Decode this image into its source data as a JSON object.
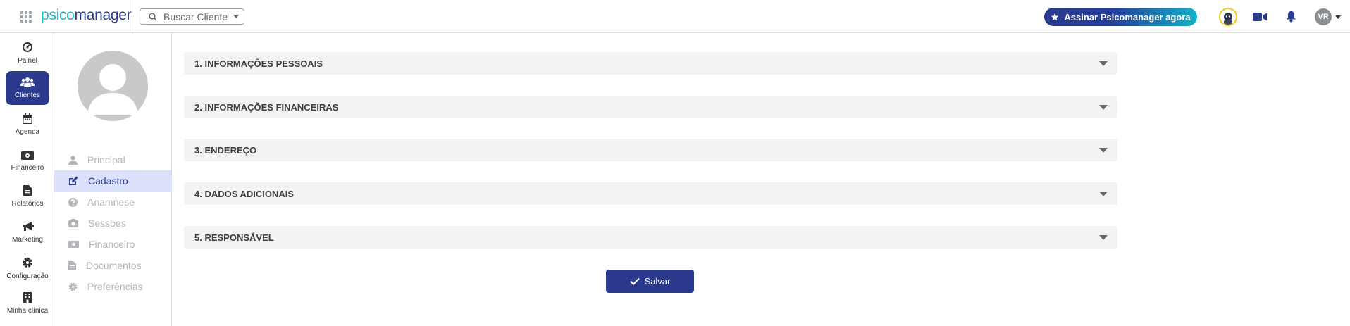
{
  "header": {
    "logo_part1": "psico",
    "logo_part2": "manager",
    "search_label": "Buscar Cliente",
    "cta_label": "Assinar Psicomanager agora",
    "user_initials": "VR"
  },
  "leftnav": {
    "items": [
      {
        "label": "Painel",
        "icon": "gauge-icon"
      },
      {
        "label": "Clientes",
        "icon": "users-icon"
      },
      {
        "label": "Agenda",
        "icon": "calendar-icon"
      },
      {
        "label": "Financeiro",
        "icon": "money-icon"
      },
      {
        "label": "Relatórios",
        "icon": "document-icon"
      },
      {
        "label": "Marketing",
        "icon": "megaphone-icon"
      },
      {
        "label": "Configuração",
        "icon": "gear-icon"
      },
      {
        "label": "Minha clínica",
        "icon": "building-icon"
      }
    ],
    "active_index": 1
  },
  "subnav": {
    "items": [
      {
        "label": "Principal",
        "icon": "user-icon"
      },
      {
        "label": "Cadastro",
        "icon": "edit-icon"
      },
      {
        "label": "Anamnese",
        "icon": "question-icon"
      },
      {
        "label": "Sessões",
        "icon": "camera-icon"
      },
      {
        "label": "Financeiro",
        "icon": "money-icon"
      },
      {
        "label": "Documentos",
        "icon": "file-icon"
      },
      {
        "label": "Preferências",
        "icon": "gear-icon"
      }
    ],
    "active_index": 1
  },
  "sections": [
    {
      "label": "1. INFORMAÇÕES PESSOAIS"
    },
    {
      "label": "2. INFORMAÇÕES FINANCEIRAS"
    },
    {
      "label": "3. ENDEREÇO"
    },
    {
      "label": "4. DADOS ADICIONAIS"
    },
    {
      "label": "5. RESPONSÁVEL"
    }
  ],
  "actions": {
    "save_label": "Salvar"
  },
  "colors": {
    "primary": "#2b3a8c",
    "accent": "#1ab4c9",
    "active_subnav_bg": "#dbe1fb"
  }
}
